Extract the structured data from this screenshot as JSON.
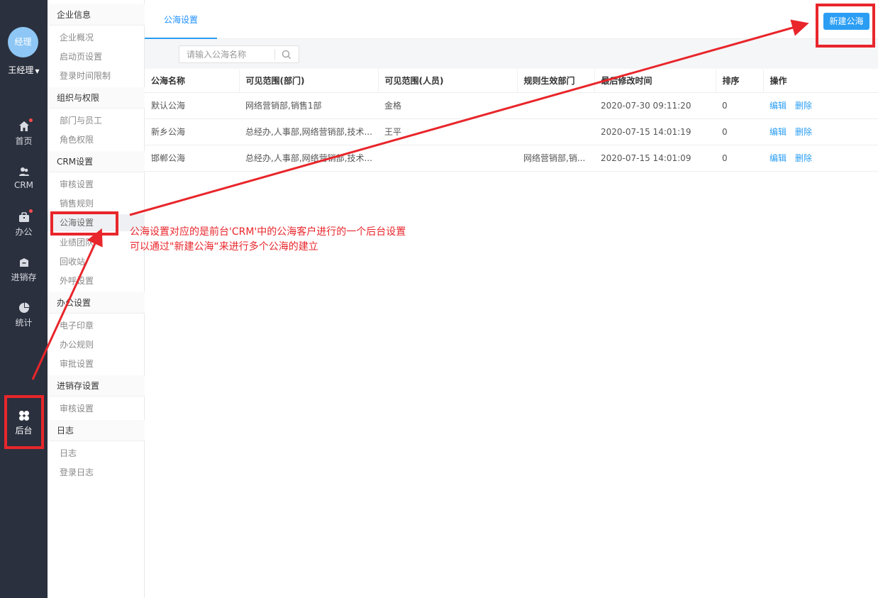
{
  "user": {
    "avatar_text": "经理",
    "name": "王经理"
  },
  "rail": [
    {
      "label": "首页",
      "icon": "home-icon",
      "badge": true
    },
    {
      "label": "CRM",
      "icon": "users-icon",
      "badge": false
    },
    {
      "label": "办公",
      "icon": "briefcase-icon",
      "badge": true
    },
    {
      "label": "进销存",
      "icon": "box-icon",
      "badge": false
    },
    {
      "label": "统计",
      "icon": "pie-chart-icon",
      "badge": false
    },
    {
      "label": "后台",
      "icon": "grid-icon",
      "badge": false
    }
  ],
  "menu": {
    "groups": [
      {
        "title": "企业信息",
        "items": [
          "企业概况",
          "启动页设置",
          "登录时间限制"
        ]
      },
      {
        "title": "组织与权限",
        "items": [
          "部门与员工",
          "角色权限"
        ]
      },
      {
        "title": "CRM设置",
        "items": [
          "审核设置",
          "销售规则",
          "公海设置",
          "业绩团队",
          "回收站",
          "外呼设置"
        ]
      },
      {
        "title": "办公设置",
        "items": [
          "电子印章",
          "办公规则",
          "审批设置"
        ]
      },
      {
        "title": "进销存设置",
        "items": [
          "审核设置"
        ]
      },
      {
        "title": "日志",
        "items": [
          "日志",
          "登录日志"
        ]
      }
    ],
    "active_item": "公海设置"
  },
  "tab": {
    "label": "公海设置"
  },
  "new_button": {
    "label": "新建公海"
  },
  "search": {
    "placeholder": "请输入公海名称"
  },
  "table": {
    "columns": [
      "公海名称",
      "可见范围(部门)",
      "可见范围(人员)",
      "规则生效部门",
      "最后修改时间",
      "排序",
      "操作"
    ],
    "rows": [
      {
        "name": "默认公海",
        "dept": "网络营销部,销售1部",
        "people": "金格",
        "rule_dept": "",
        "time": "2020-07-30 09:11:20",
        "order": "0",
        "edit": "编辑",
        "delete": "删除"
      },
      {
        "name": "新乡公海",
        "dept": "总经办,人事部,网络营销部,技术...",
        "people": "王平",
        "rule_dept": "",
        "time": "2020-07-15 14:01:19",
        "order": "0",
        "edit": "编辑",
        "delete": "删除"
      },
      {
        "name": "邯郸公海",
        "dept": "总经办,人事部,网络营销部,技术...",
        "people": "",
        "rule_dept": "网络营销部,销...",
        "time": "2020-07-15 14:01:09",
        "order": "0",
        "edit": "编辑",
        "delete": "删除"
      }
    ]
  },
  "annotation": {
    "line1": "公海设置对应的是前台'CRM'中的公海客户进行的一个后台设置",
    "line2": "可以通过\"新建公海“来进行多个公海的建立",
    "color": "#e8262b"
  }
}
